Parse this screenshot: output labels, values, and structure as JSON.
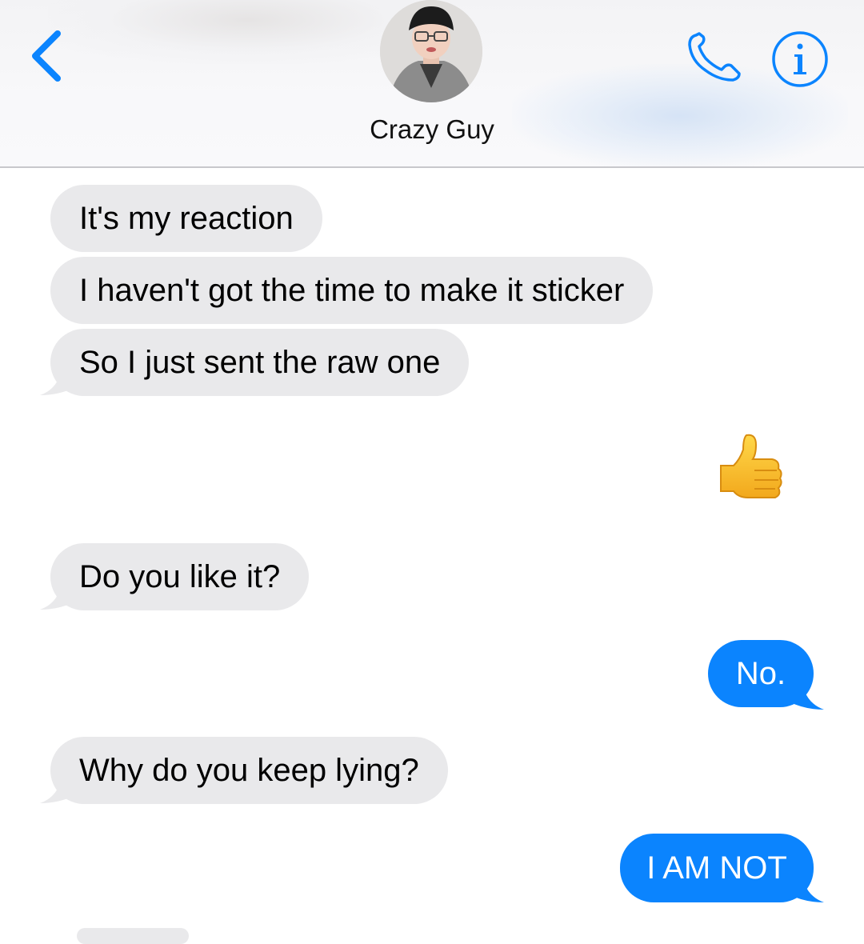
{
  "header": {
    "contact_name": "Crazy Guy",
    "back_icon": "chevron-left-icon",
    "phone_icon": "phone-icon",
    "info_icon": "info-icon",
    "accent_color": "#0b84fe"
  },
  "messages": [
    {
      "direction": "incoming",
      "text": "It's my reaction"
    },
    {
      "direction": "incoming",
      "text": "I haven't got the time to make it sticker"
    },
    {
      "direction": "incoming",
      "text": "So I just sent the raw one"
    },
    {
      "direction": "outgoing",
      "type": "emoji",
      "text": "thumbs-up-emoji"
    },
    {
      "direction": "incoming",
      "text": "Do you like it?"
    },
    {
      "direction": "outgoing",
      "text": "No."
    },
    {
      "direction": "incoming",
      "text": "Why do you keep lying?"
    },
    {
      "direction": "outgoing",
      "text": "I AM NOT"
    }
  ],
  "colors": {
    "incoming_bubble": "#e9e9eb",
    "outgoing_bubble": "#0b84fe",
    "outgoing_text": "#ffffff"
  }
}
